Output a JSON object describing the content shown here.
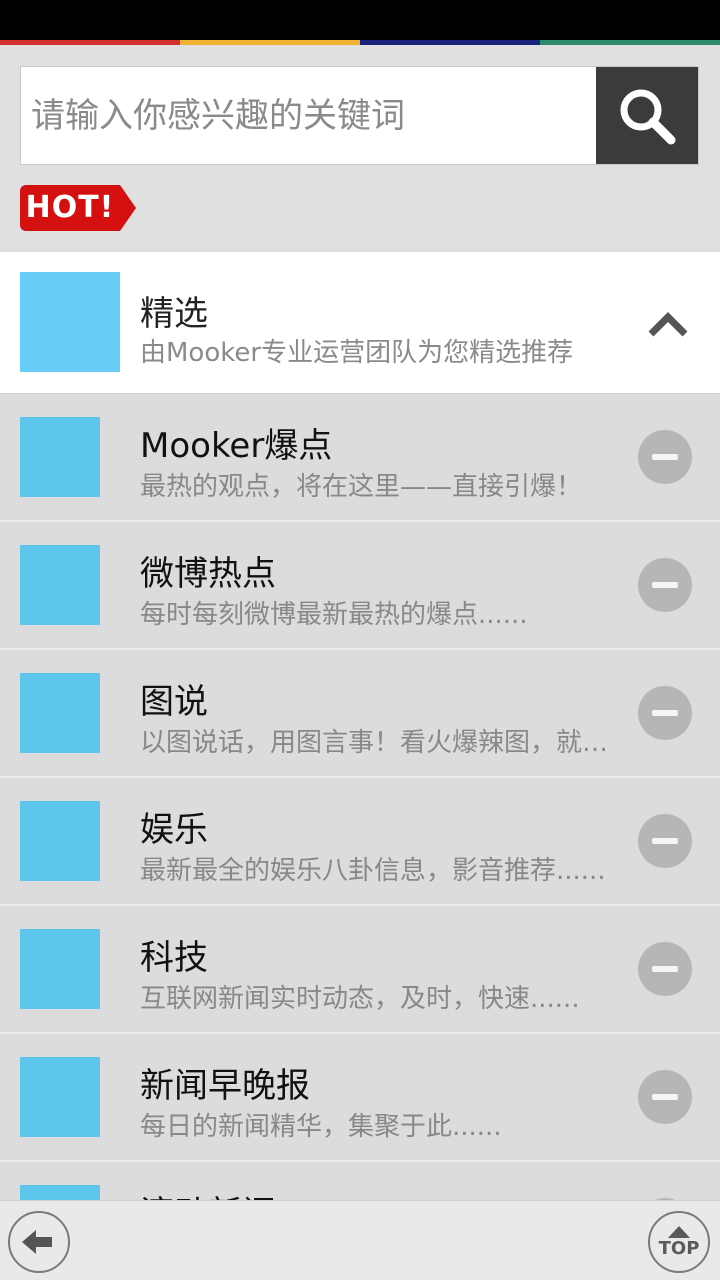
{
  "color_strip": [
    "#d32f2f",
    "#f2b233",
    "#1a237e",
    "#2e8b6a"
  ],
  "search": {
    "placeholder": "请输入你感兴趣的关键词"
  },
  "hot_badge": "HOT!",
  "featured": {
    "title": "精选",
    "subtitle": "由Mooker专业运营团队为您精选推荐"
  },
  "channels": [
    {
      "title": "Mooker爆点",
      "subtitle": "最热的观点，将在这里——直接引爆！"
    },
    {
      "title": "微博热点",
      "subtitle": "每时每刻微博最新最热的爆点......"
    },
    {
      "title": "图说",
      "subtitle": "以图说话，用图言事！看火爆辣图，就在这里......"
    },
    {
      "title": "娱乐",
      "subtitle": "最新最全的娱乐八卦信息，影音推荐......"
    },
    {
      "title": "科技",
      "subtitle": "互联网新闻实时动态，及时，快速......"
    },
    {
      "title": "新闻早晚报",
      "subtitle": "每日的新闻精华，集聚于此......"
    },
    {
      "title": "滚动新闻",
      "subtitle": ""
    }
  ],
  "bottom": {
    "top_label": "TOP"
  }
}
